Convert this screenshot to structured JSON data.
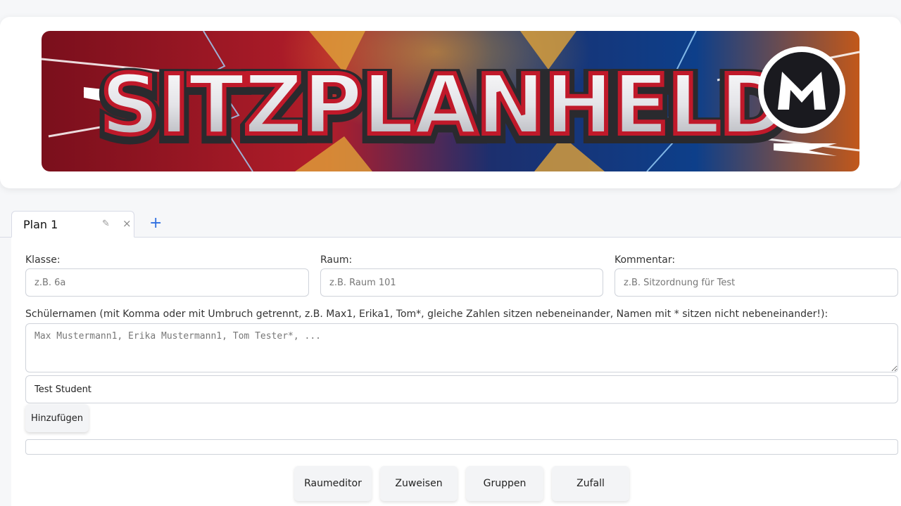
{
  "banner": {
    "title": "SITZPLANHELD",
    "logo_letter": "M"
  },
  "tabs": {
    "items": [
      {
        "label": "Plan 1",
        "edit_icon": "✎",
        "close_icon": "×"
      }
    ],
    "add_label": "+"
  },
  "form": {
    "klasse": {
      "label": "Klasse:",
      "placeholder": "z.B. 6a",
      "value": ""
    },
    "raum": {
      "label": "Raum:",
      "placeholder": "z.B. Raum 101",
      "value": ""
    },
    "kommentar": {
      "label": "Kommentar:",
      "placeholder": "z.B. Sitzordnung für Test",
      "value": ""
    },
    "students": {
      "label": "Schülernamen (mit Komma oder mit Umbruch getrennt, z.B. Max1, Erika1, Tom*, gleiche Zahlen sitzen nebeneinander, Namen mit * sitzen nicht nebeneinander!):",
      "placeholder": "Max Mustermann1, Erika Mustermann1, Tom Tester*, ...",
      "value": ""
    },
    "single_student": {
      "value": "Test Student"
    },
    "add_button": "Hinzufügen"
  },
  "actions": {
    "raumeditor": "Raumeditor",
    "zuweisen": "Zuweisen",
    "gruppen": "Gruppen",
    "zufall": "Zufall"
  }
}
